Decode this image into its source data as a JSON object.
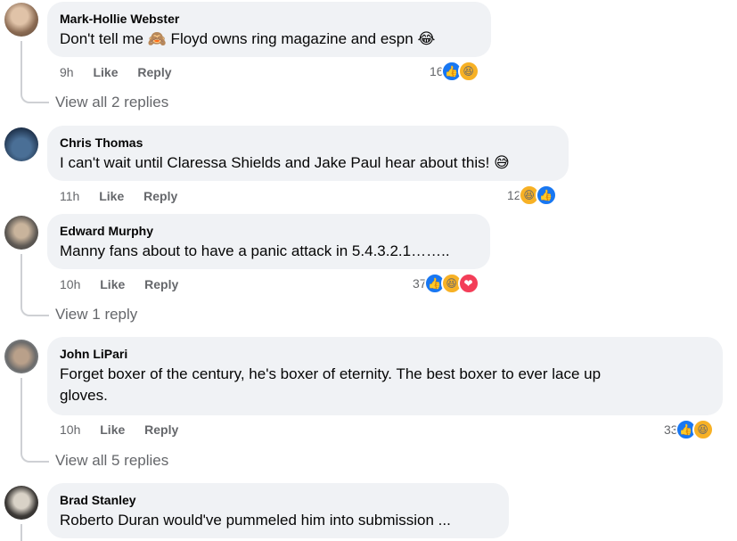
{
  "comments": [
    {
      "name": "Mark-Hollie Webster",
      "text": "Don't tell me 🙈 Floyd owns ring magazine and espn 😂",
      "time": "9h",
      "like": "Like",
      "reply": "Reply",
      "reactions_count": "16",
      "view_replies": "View all 2 replies"
    },
    {
      "name": "Chris Thomas",
      "text": "I can't wait until Claressa Shields and Jake Paul hear about this! 😅",
      "time": "11h",
      "like": "Like",
      "reply": "Reply",
      "reactions_count": "12"
    },
    {
      "name": "Edward Murphy",
      "text": "Manny fans about to have a panic attack in 5.4.3.2.1……..",
      "time": "10h",
      "like": "Like",
      "reply": "Reply",
      "reactions_count": "37",
      "view_replies": "View 1 reply"
    },
    {
      "name": "John LiPari",
      "text_line1": "Forget boxer of the century, he's boxer of eternity. The best boxer to ever lace up",
      "text_line2": "gloves.",
      "time": "10h",
      "like": "Like",
      "reply": "Reply",
      "reactions_count": "33",
      "view_replies": "View all 5 replies"
    },
    {
      "name": "Brad Stanley",
      "text": "Roberto Duran would've pummeled him into submission ..."
    }
  ],
  "reaction_icons": {
    "like": "👍",
    "haha": "😆",
    "love": "❤"
  },
  "colors": {
    "bubble": "#f0f2f5",
    "meta": "#65676b",
    "like_blue": "#1877f2",
    "haha_yellow": "#f7b125",
    "love_red": "#f33e58"
  }
}
